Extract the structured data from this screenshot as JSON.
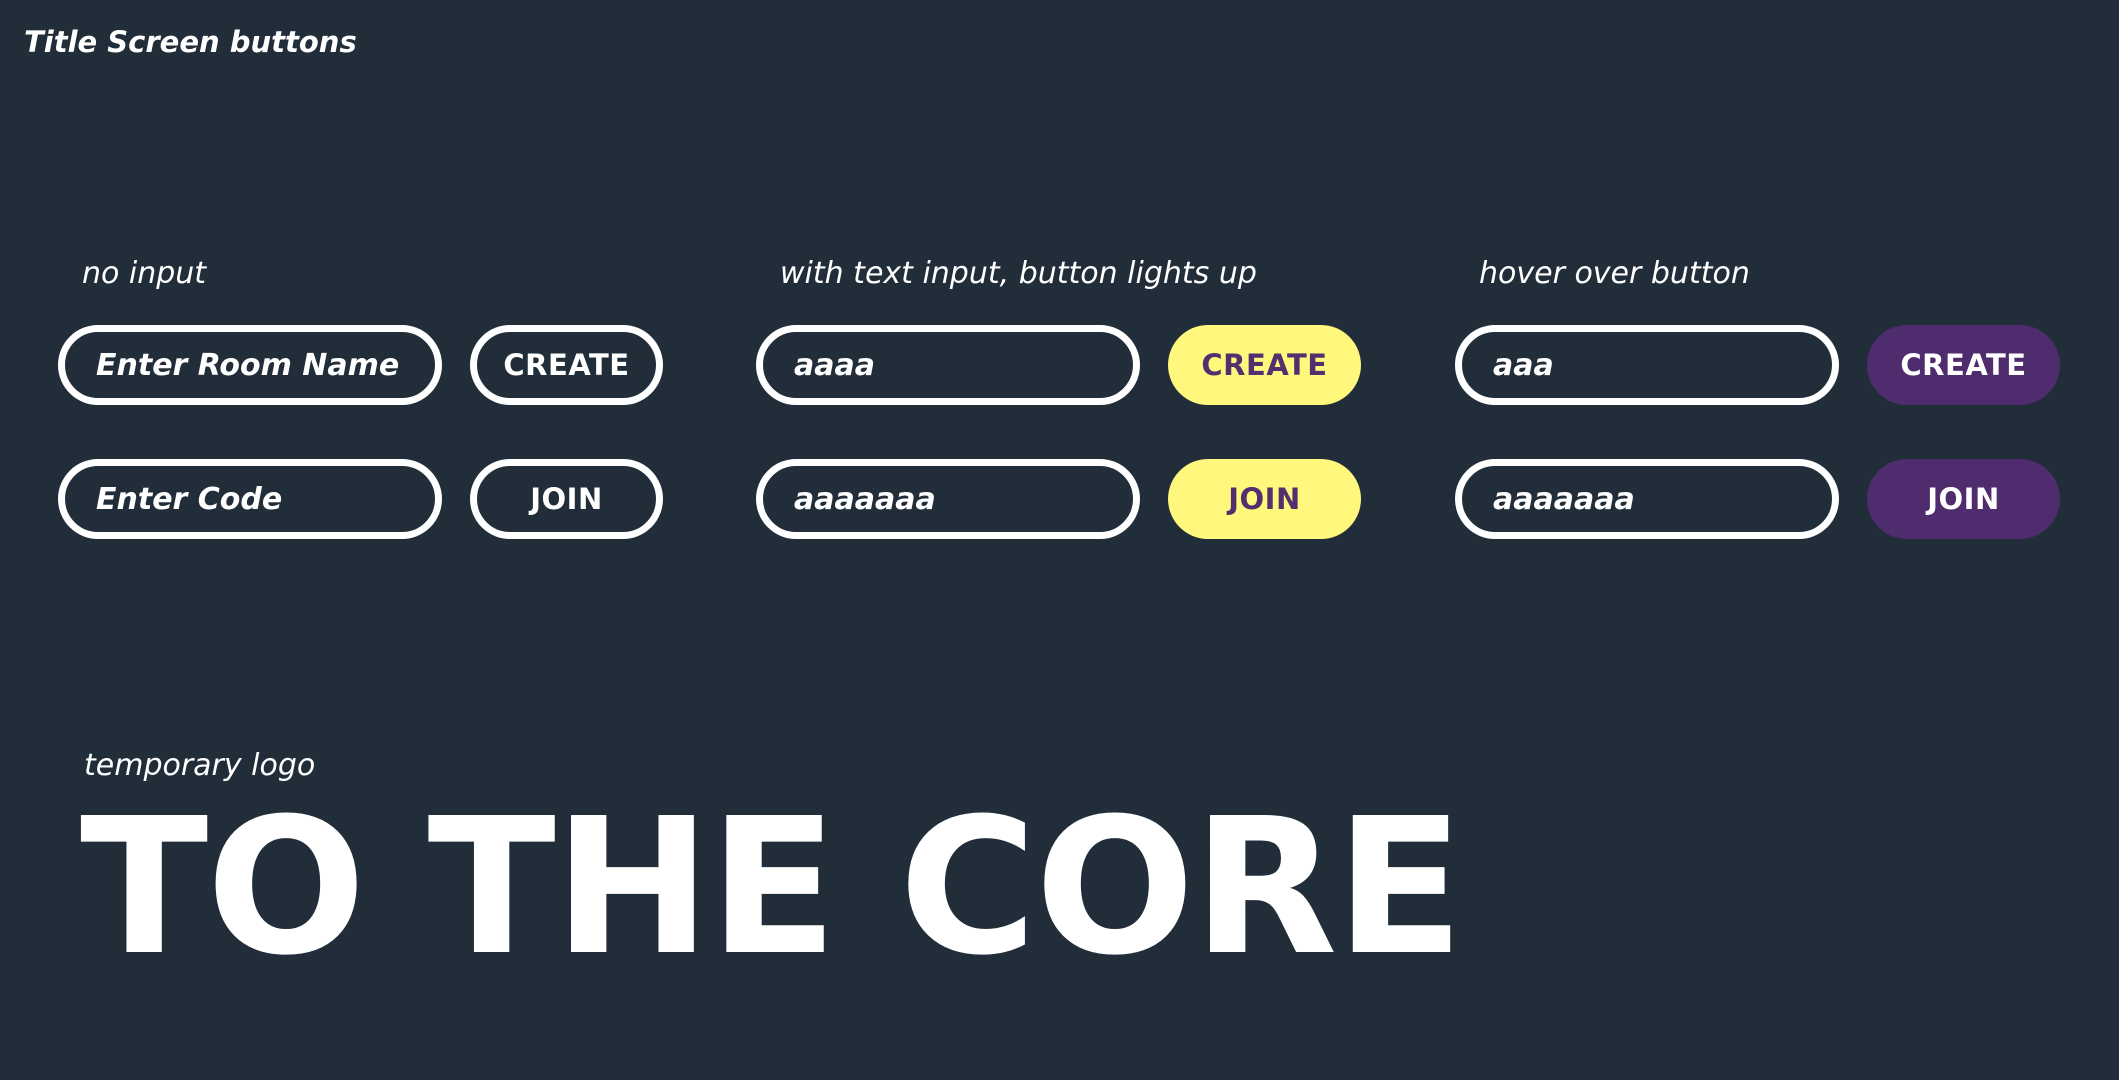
{
  "page": {
    "title": "Title Screen buttons"
  },
  "columns": [
    {
      "label": "no input",
      "room_field": "Enter Room Name",
      "create_label": "CREATE",
      "code_field": "Enter Code",
      "join_label": "JOIN",
      "button_style": "outline"
    },
    {
      "label": "with text input, button lights up",
      "room_field": "aaaa",
      "create_label": "CREATE",
      "code_field": "aaaaaaa",
      "join_label": "JOIN",
      "button_style": "yellow"
    },
    {
      "label": "hover over button",
      "room_field": "aaa",
      "create_label": "CREATE",
      "code_field": "aaaaaaa",
      "join_label": "JOIN",
      "button_style": "purple"
    }
  ],
  "logo": {
    "label": "temporary logo",
    "text": "TO THE CORE"
  },
  "colors": {
    "background": "#222d3a",
    "outline": "#ffffff",
    "lit_button": "#fff87c",
    "hover_button": "#4f2c6e",
    "lit_button_text": "#52306e"
  }
}
